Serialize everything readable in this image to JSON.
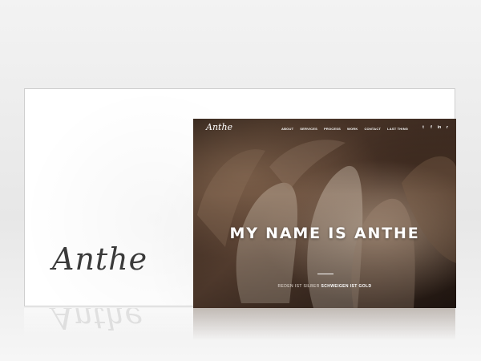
{
  "brand": {
    "logo_large": "Anthe",
    "logo_small": "Anthe"
  },
  "nav": {
    "items": [
      "ABOUT",
      "SERVICES",
      "PROCESS",
      "WORK",
      "CONTACT",
      "LAST THING"
    ]
  },
  "social": {
    "twitter": "t",
    "facebook": "f",
    "linkedin": "in",
    "rss": "r"
  },
  "hero": {
    "headline": "MY NAME IS ANTHE",
    "tagline_prefix": "REDEN IST SILBER",
    "tagline_bold": "SCHWEIGEN IST GOLD"
  },
  "colors": {
    "accent": "#ffffff",
    "hero_tone": "#6d4f3d"
  }
}
